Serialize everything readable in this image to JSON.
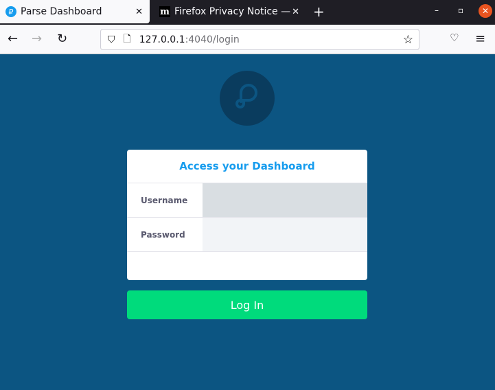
{
  "browser": {
    "tabs": [
      {
        "title": "Parse Dashboard",
        "active": true
      },
      {
        "title": "Firefox Privacy Notice —"
      }
    ],
    "url_host": "127.0.0.1",
    "url_path": ":4040/login"
  },
  "login": {
    "title": "Access your Dashboard",
    "username_label": "Username",
    "username_value": "",
    "password_label": "Password",
    "password_value": "",
    "button": "Log In"
  },
  "colors": {
    "background": "#0c5582",
    "accent": "#169cee",
    "button": "#00db7c"
  }
}
